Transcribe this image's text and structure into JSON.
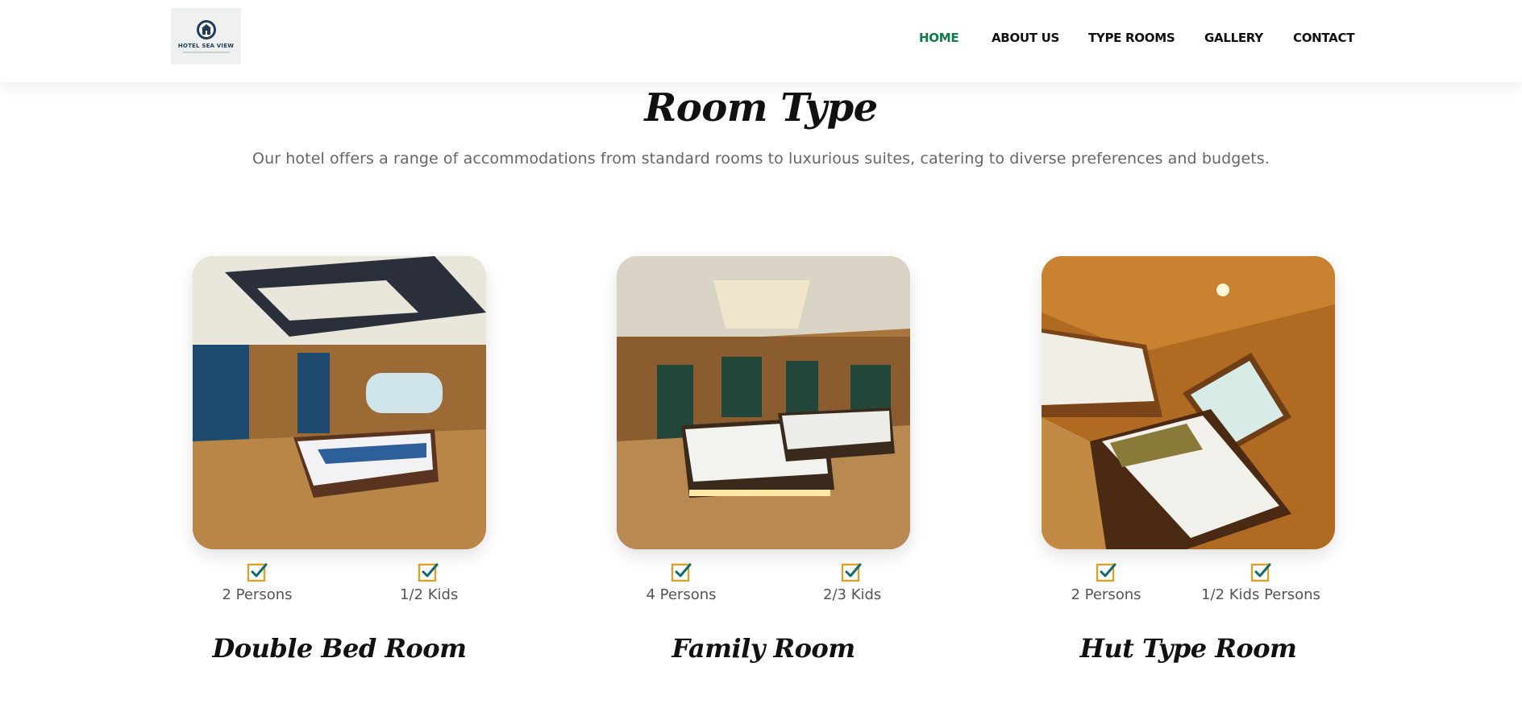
{
  "header": {
    "logo": {
      "icon": "hotel-emblem-icon",
      "text": "HOTEL SEA VIEW"
    },
    "nav": [
      {
        "label": "HOME",
        "active": true
      },
      {
        "label": "ABOUT US",
        "active": false
      },
      {
        "label": "TYPE ROOMS",
        "active": false
      },
      {
        "label": "GALLERY",
        "active": false
      },
      {
        "label": "CONTACT",
        "active": false
      }
    ]
  },
  "section": {
    "title": "Room Type",
    "subtitle": "Our hotel offers a range of accommodations from standard rooms to luxurious suites, catering to diverse preferences and budgets."
  },
  "rooms": [
    {
      "name": "Double Bed Room",
      "photo": "double-bed-room-photo",
      "features": [
        {
          "icon": "checkbox-checked-icon",
          "label": "2 Persons"
        },
        {
          "icon": "checkbox-checked-icon",
          "label": "1/2 Kids"
        }
      ]
    },
    {
      "name": "Family Room",
      "photo": "family-room-photo",
      "features": [
        {
          "icon": "checkbox-checked-icon",
          "label": "4 Persons"
        },
        {
          "icon": "checkbox-checked-icon",
          "label": "2/3 Kids"
        }
      ]
    },
    {
      "name": "Hut Type Room",
      "photo": "hut-type-room-photo",
      "features": [
        {
          "icon": "checkbox-checked-icon",
          "label": "2 Persons"
        },
        {
          "icon": "checkbox-checked-icon",
          "label": "1/2 Kids Persons"
        }
      ]
    }
  ],
  "colors": {
    "nav_active": "#0f7a4a",
    "nav_text": "#111111",
    "check_box": "#d9a32a",
    "check_mark": "#0f6b73",
    "subtitle_text": "#666666"
  }
}
